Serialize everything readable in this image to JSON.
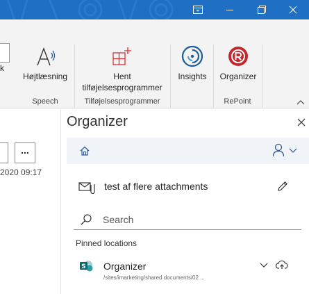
{
  "window": {
    "controls": [
      "ribbon-display-icon",
      "minimize-icon",
      "restore-icon",
      "close-icon"
    ]
  },
  "ribbon": {
    "cut_label": "k",
    "buttons": {
      "read_aloud": "Højtlæsning",
      "get_addins_line1": "Hent",
      "get_addins_line2": "tilføjelsesprogrammer",
      "insights": "Insights",
      "organizer": "Organizer"
    },
    "groups": {
      "speech": "Speech",
      "addins": "Tilføjelsesprogrammer",
      "repoint": "RePoint"
    }
  },
  "left_pane": {
    "more_label": "...",
    "date": "2020 09:17"
  },
  "organizer": {
    "title": "Organizer",
    "mail_subject": "test af flere attachments",
    "search_placeholder": "Search",
    "pinned_heading": "Pinned locations",
    "locations": [
      {
        "name": "Organizer",
        "path": "/sites/imarketing/shared documents/02 ..."
      }
    ]
  },
  "colors": {
    "titlebar": "#1f6fc5",
    "repoint_red": "#c4262e",
    "insights_blue": "#1c5d99",
    "addins_red": "#d13438",
    "accent_blue": "#2b579a"
  }
}
